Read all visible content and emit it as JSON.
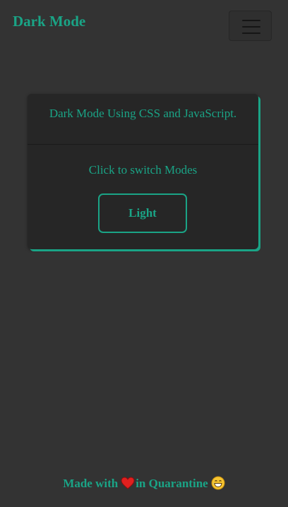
{
  "navbar": {
    "brand": "Dark Mode",
    "toggler_icon": "hamburger-menu-icon"
  },
  "card": {
    "title": "Dark Mode Using CSS and JavaScript.",
    "subtitle": "Click to switch Modes",
    "button_label": "Light"
  },
  "footer": {
    "prefix": "Made with",
    "heart_icon": "heart-icon",
    "suffix": "in Quarantine",
    "emoji_icon": "grinning-sweat-emoji-icon"
  },
  "colors": {
    "background": "#333333",
    "card_background": "#262626",
    "accent": "#1aa486"
  }
}
